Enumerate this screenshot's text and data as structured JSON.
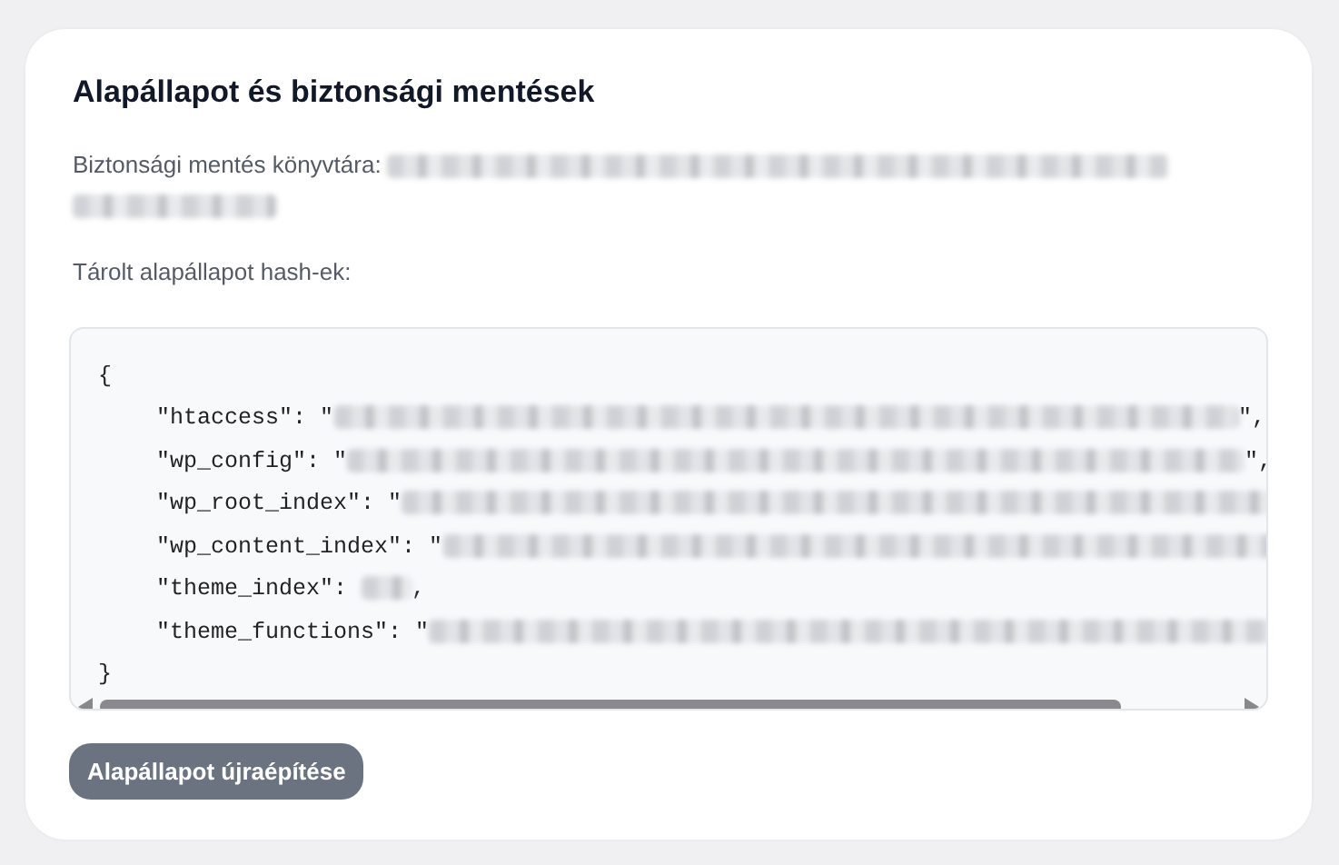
{
  "card": {
    "title": "Alapállapot és biztonsági mentések",
    "backup_dir_label": "Biztonsági mentés könyvtára:",
    "hashes_label": "Tárolt alapállapot hash-ek:",
    "code": {
      "open": "{",
      "close": "}",
      "entries": [
        {
          "prefix": "\"htaccess\": \"",
          "suffix": "\","
        },
        {
          "prefix": "\"wp_config\": \"",
          "suffix": "\","
        },
        {
          "prefix": "\"wp_root_index\": \""
        },
        {
          "prefix": "\"wp_content_index\": \""
        },
        {
          "prefix": "\"theme_index\": ",
          "suffix": ","
        },
        {
          "prefix": "\"theme_functions\": \""
        }
      ]
    },
    "button": "Alapállapot újraépítése"
  }
}
